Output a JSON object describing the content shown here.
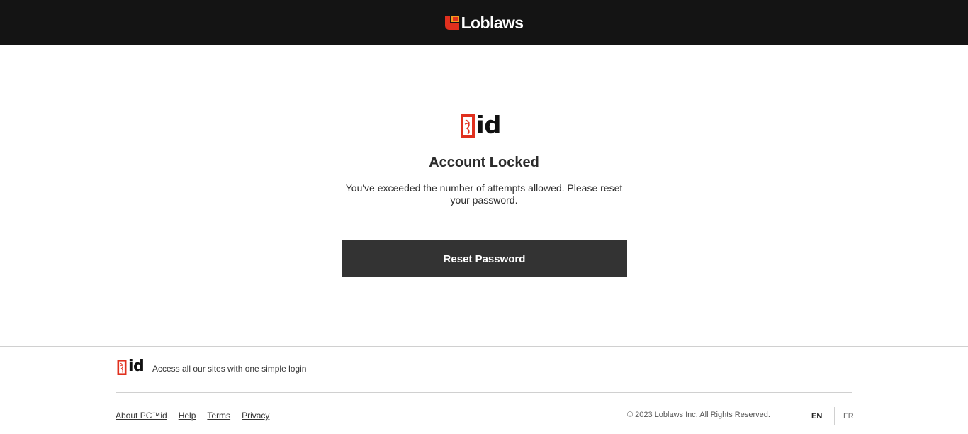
{
  "header": {
    "brand_name": "Loblaws",
    "brand_color": "#ffffff",
    "brand_mark_color": "#e0301e"
  },
  "main": {
    "logo_text": "id",
    "title": "Account Locked",
    "message": "You've exceeded the number of attempts allowed. Please reset your password.",
    "reset_button_label": "Reset Password",
    "button_color": "#333333"
  },
  "footer": {
    "logo_text": "id",
    "tagline": "Access all our sites with one simple login",
    "links": [
      {
        "label": "About PC™id"
      },
      {
        "label": "Help"
      },
      {
        "label": "Terms"
      },
      {
        "label": "Privacy"
      }
    ],
    "copyright": "© 2023 Loblaws Inc. All Rights Reserved.",
    "languages": [
      {
        "label": "EN",
        "active": true
      },
      {
        "label": "FR",
        "active": false
      }
    ]
  },
  "icons": {
    "brand_mark": "loblaws-logo-icon",
    "pc_flag": "pc-flag-icon"
  }
}
